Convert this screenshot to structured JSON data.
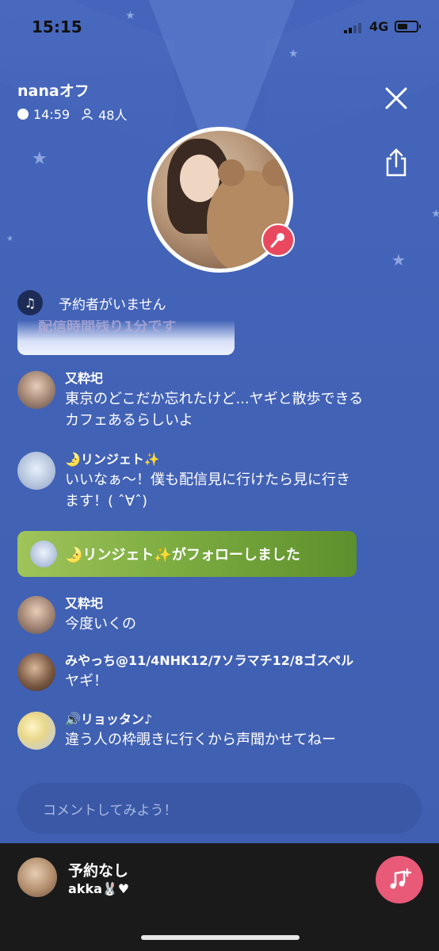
{
  "status_bar": {
    "time": "15:15",
    "network": "4G"
  },
  "room": {
    "title": "nanaオフ",
    "elapsed": "14:59",
    "listeners": "48人"
  },
  "queue": {
    "label": "予約者がいません"
  },
  "faded_banner": {
    "text": "配信時間残り1分です"
  },
  "comments": [
    {
      "name": "又粋圯",
      "text_lines": [
        "東京のどこだか忘れたけど...ヤギと散歩できる",
        "カフェあるらしいよ"
      ]
    },
    {
      "name": "🌛リンジェト✨",
      "text_lines": [
        "いいなぁ〜！僕も配信見に行けたら見に行き",
        "ます！( ˆ∀ˆ)"
      ]
    },
    {
      "name": "又粋圯",
      "text_lines": [
        "今度いくの"
      ]
    },
    {
      "name": "みやっち@11/4NHK12/7ソラマチ12/8ゴスペル",
      "text_lines": [
        "ヤギ！"
      ]
    },
    {
      "name": "🔊リョッタン♪",
      "text_lines": [
        "違う人の枠覗きに行くから声聞かせてねー"
      ]
    }
  ],
  "follow_banner": {
    "text": "🌛リンジェト✨がフォローしました"
  },
  "comment_input": {
    "placeholder": "コメントしてみよう！"
  },
  "bottom_bar": {
    "title": "予約なし",
    "host": "akka🐰♥"
  },
  "icons": {
    "close": "close-icon",
    "share": "share-icon",
    "mic": "microphone-icon",
    "note": "music-note-icon",
    "request": "music-add-icon",
    "person": "person-icon"
  },
  "colors": {
    "stage_bg": "#4262b5",
    "follow_green": "#7aaa3f",
    "mic_red": "#e8495f",
    "request_pink": "#e85a78",
    "bottom_bg": "#1a1a1a"
  }
}
